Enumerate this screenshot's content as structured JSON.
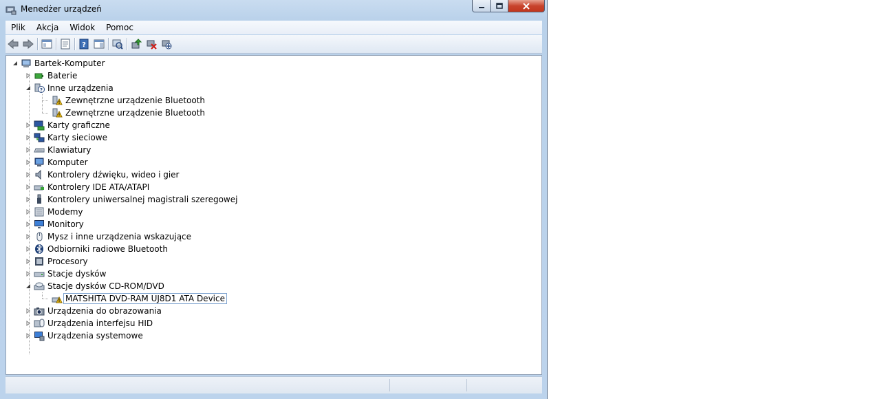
{
  "window": {
    "title": "Menedżer urządzeń",
    "title_icon": "device-manager-icon"
  },
  "menu": [
    "Plik",
    "Akcja",
    "Widok",
    "Pomoc"
  ],
  "toolbar": [
    {
      "name": "back-icon"
    },
    {
      "name": "forward-icon"
    },
    {
      "name": "show-hide-console-tree-icon"
    },
    {
      "name": "properties-icon"
    },
    {
      "name": "help-icon"
    },
    {
      "name": "action-pane-icon"
    },
    {
      "name": "scan-hardware-changes-icon"
    },
    {
      "name": "update-driver-icon"
    },
    {
      "name": "uninstall-icon"
    },
    {
      "name": "disable-device-icon"
    }
  ],
  "tree": {
    "root": "Bartek-Komputer",
    "items": [
      {
        "label": "Baterie",
        "icon": "battery-icon",
        "expanded": false
      },
      {
        "label": "Inne urządzenia",
        "icon": "unknown-device-icon",
        "expanded": true,
        "children": [
          {
            "label": "Zewnętrzne urządzenie Bluetooth",
            "icon": "warning-device-icon"
          },
          {
            "label": "Zewnętrzne urządzenie Bluetooth",
            "icon": "warning-device-icon"
          }
        ]
      },
      {
        "label": "Karty graficzne",
        "icon": "display-adapter-icon",
        "expanded": false
      },
      {
        "label": "Karty sieciowe",
        "icon": "network-adapter-icon",
        "expanded": false
      },
      {
        "label": "Klawiatury",
        "icon": "keyboard-icon",
        "expanded": false
      },
      {
        "label": "Komputer",
        "icon": "computer-icon",
        "expanded": false
      },
      {
        "label": "Kontrolery dźwięku, wideo i gier",
        "icon": "speaker-icon",
        "expanded": false
      },
      {
        "label": "Kontrolery IDE ATA/ATAPI",
        "icon": "ide-controller-icon",
        "expanded": false
      },
      {
        "label": "Kontrolery uniwersalnej magistrali szeregowej",
        "icon": "usb-icon",
        "expanded": false
      },
      {
        "label": "Modemy",
        "icon": "modem-icon",
        "expanded": false
      },
      {
        "label": "Monitory",
        "icon": "monitor-icon",
        "expanded": false
      },
      {
        "label": "Mysz i inne urządzenia wskazujące",
        "icon": "mouse-icon",
        "expanded": false
      },
      {
        "label": "Odbiorniki radiowe Bluetooth",
        "icon": "bluetooth-icon",
        "expanded": false
      },
      {
        "label": "Procesory",
        "icon": "processor-icon",
        "expanded": false
      },
      {
        "label": "Stacje dysków",
        "icon": "disk-drive-icon",
        "expanded": false
      },
      {
        "label": "Stacje dysków CD-ROM/DVD",
        "icon": "cdrom-icon",
        "expanded": true,
        "children": [
          {
            "label": "MATSHITA DVD-RAM UJ8D1 ATA Device",
            "icon": "warning-device-icon",
            "selected": true
          }
        ]
      },
      {
        "label": "Urządzenia do obrazowania",
        "icon": "camera-icon",
        "expanded": false
      },
      {
        "label": "Urządzenia interfejsu HID",
        "icon": "hid-icon",
        "expanded": false
      },
      {
        "label": "Urządzenia systemowe",
        "icon": "system-device-icon",
        "expanded": false
      }
    ]
  },
  "colors": {
    "accent": "#c8442d",
    "frame": "#bcd3ec",
    "selection_border": "#7da2ce"
  }
}
